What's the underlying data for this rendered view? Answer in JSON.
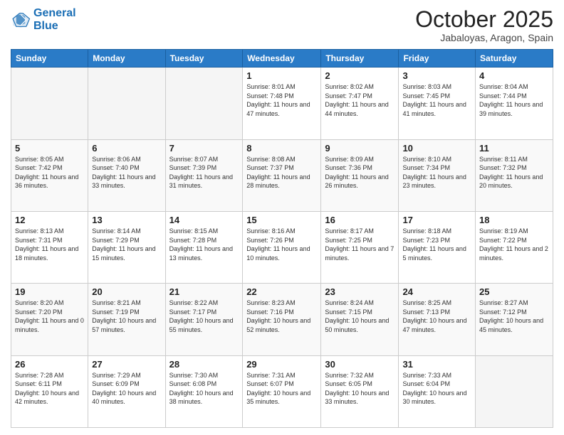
{
  "header": {
    "logo_line1": "General",
    "logo_line2": "Blue",
    "month_title": "October 2025",
    "location": "Jabaloyas, Aragon, Spain"
  },
  "weekdays": [
    "Sunday",
    "Monday",
    "Tuesday",
    "Wednesday",
    "Thursday",
    "Friday",
    "Saturday"
  ],
  "weeks": [
    [
      {
        "day": "",
        "sunrise": "",
        "sunset": "",
        "daylight": ""
      },
      {
        "day": "",
        "sunrise": "",
        "sunset": "",
        "daylight": ""
      },
      {
        "day": "",
        "sunrise": "",
        "sunset": "",
        "daylight": ""
      },
      {
        "day": "1",
        "sunrise": "Sunrise: 8:01 AM",
        "sunset": "Sunset: 7:48 PM",
        "daylight": "Daylight: 11 hours and 47 minutes."
      },
      {
        "day": "2",
        "sunrise": "Sunrise: 8:02 AM",
        "sunset": "Sunset: 7:47 PM",
        "daylight": "Daylight: 11 hours and 44 minutes."
      },
      {
        "day": "3",
        "sunrise": "Sunrise: 8:03 AM",
        "sunset": "Sunset: 7:45 PM",
        "daylight": "Daylight: 11 hours and 41 minutes."
      },
      {
        "day": "4",
        "sunrise": "Sunrise: 8:04 AM",
        "sunset": "Sunset: 7:44 PM",
        "daylight": "Daylight: 11 hours and 39 minutes."
      }
    ],
    [
      {
        "day": "5",
        "sunrise": "Sunrise: 8:05 AM",
        "sunset": "Sunset: 7:42 PM",
        "daylight": "Daylight: 11 hours and 36 minutes."
      },
      {
        "day": "6",
        "sunrise": "Sunrise: 8:06 AM",
        "sunset": "Sunset: 7:40 PM",
        "daylight": "Daylight: 11 hours and 33 minutes."
      },
      {
        "day": "7",
        "sunrise": "Sunrise: 8:07 AM",
        "sunset": "Sunset: 7:39 PM",
        "daylight": "Daylight: 11 hours and 31 minutes."
      },
      {
        "day": "8",
        "sunrise": "Sunrise: 8:08 AM",
        "sunset": "Sunset: 7:37 PM",
        "daylight": "Daylight: 11 hours and 28 minutes."
      },
      {
        "day": "9",
        "sunrise": "Sunrise: 8:09 AM",
        "sunset": "Sunset: 7:36 PM",
        "daylight": "Daylight: 11 hours and 26 minutes."
      },
      {
        "day": "10",
        "sunrise": "Sunrise: 8:10 AM",
        "sunset": "Sunset: 7:34 PM",
        "daylight": "Daylight: 11 hours and 23 minutes."
      },
      {
        "day": "11",
        "sunrise": "Sunrise: 8:11 AM",
        "sunset": "Sunset: 7:32 PM",
        "daylight": "Daylight: 11 hours and 20 minutes."
      }
    ],
    [
      {
        "day": "12",
        "sunrise": "Sunrise: 8:13 AM",
        "sunset": "Sunset: 7:31 PM",
        "daylight": "Daylight: 11 hours and 18 minutes."
      },
      {
        "day": "13",
        "sunrise": "Sunrise: 8:14 AM",
        "sunset": "Sunset: 7:29 PM",
        "daylight": "Daylight: 11 hours and 15 minutes."
      },
      {
        "day": "14",
        "sunrise": "Sunrise: 8:15 AM",
        "sunset": "Sunset: 7:28 PM",
        "daylight": "Daylight: 11 hours and 13 minutes."
      },
      {
        "day": "15",
        "sunrise": "Sunrise: 8:16 AM",
        "sunset": "Sunset: 7:26 PM",
        "daylight": "Daylight: 11 hours and 10 minutes."
      },
      {
        "day": "16",
        "sunrise": "Sunrise: 8:17 AM",
        "sunset": "Sunset: 7:25 PM",
        "daylight": "Daylight: 11 hours and 7 minutes."
      },
      {
        "day": "17",
        "sunrise": "Sunrise: 8:18 AM",
        "sunset": "Sunset: 7:23 PM",
        "daylight": "Daylight: 11 hours and 5 minutes."
      },
      {
        "day": "18",
        "sunrise": "Sunrise: 8:19 AM",
        "sunset": "Sunset: 7:22 PM",
        "daylight": "Daylight: 11 hours and 2 minutes."
      }
    ],
    [
      {
        "day": "19",
        "sunrise": "Sunrise: 8:20 AM",
        "sunset": "Sunset: 7:20 PM",
        "daylight": "Daylight: 11 hours and 0 minutes."
      },
      {
        "day": "20",
        "sunrise": "Sunrise: 8:21 AM",
        "sunset": "Sunset: 7:19 PM",
        "daylight": "Daylight: 10 hours and 57 minutes."
      },
      {
        "day": "21",
        "sunrise": "Sunrise: 8:22 AM",
        "sunset": "Sunset: 7:17 PM",
        "daylight": "Daylight: 10 hours and 55 minutes."
      },
      {
        "day": "22",
        "sunrise": "Sunrise: 8:23 AM",
        "sunset": "Sunset: 7:16 PM",
        "daylight": "Daylight: 10 hours and 52 minutes."
      },
      {
        "day": "23",
        "sunrise": "Sunrise: 8:24 AM",
        "sunset": "Sunset: 7:15 PM",
        "daylight": "Daylight: 10 hours and 50 minutes."
      },
      {
        "day": "24",
        "sunrise": "Sunrise: 8:25 AM",
        "sunset": "Sunset: 7:13 PM",
        "daylight": "Daylight: 10 hours and 47 minutes."
      },
      {
        "day": "25",
        "sunrise": "Sunrise: 8:27 AM",
        "sunset": "Sunset: 7:12 PM",
        "daylight": "Daylight: 10 hours and 45 minutes."
      }
    ],
    [
      {
        "day": "26",
        "sunrise": "Sunrise: 7:28 AM",
        "sunset": "Sunset: 6:11 PM",
        "daylight": "Daylight: 10 hours and 42 minutes."
      },
      {
        "day": "27",
        "sunrise": "Sunrise: 7:29 AM",
        "sunset": "Sunset: 6:09 PM",
        "daylight": "Daylight: 10 hours and 40 minutes."
      },
      {
        "day": "28",
        "sunrise": "Sunrise: 7:30 AM",
        "sunset": "Sunset: 6:08 PM",
        "daylight": "Daylight: 10 hours and 38 minutes."
      },
      {
        "day": "29",
        "sunrise": "Sunrise: 7:31 AM",
        "sunset": "Sunset: 6:07 PM",
        "daylight": "Daylight: 10 hours and 35 minutes."
      },
      {
        "day": "30",
        "sunrise": "Sunrise: 7:32 AM",
        "sunset": "Sunset: 6:05 PM",
        "daylight": "Daylight: 10 hours and 33 minutes."
      },
      {
        "day": "31",
        "sunrise": "Sunrise: 7:33 AM",
        "sunset": "Sunset: 6:04 PM",
        "daylight": "Daylight: 10 hours and 30 minutes."
      },
      {
        "day": "",
        "sunrise": "",
        "sunset": "",
        "daylight": ""
      }
    ]
  ]
}
